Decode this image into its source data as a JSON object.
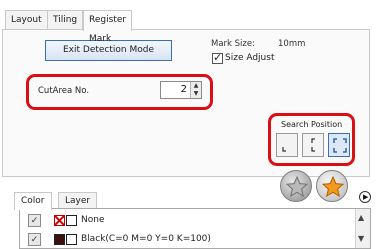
{
  "tabs": [
    {
      "label": "Layout",
      "active": false
    },
    {
      "label": "Tiling",
      "active": false
    },
    {
      "label": "Register Mark",
      "active": true
    }
  ],
  "register_mark": {
    "exit_detection_label": "Exit Detection Mode",
    "mark_size_label": "Mark Size:",
    "mark_size_value": "10mm",
    "size_adjust_label": "Size Adjust",
    "size_adjust_checked": true
  },
  "cut_area": {
    "label": "CutArea No.",
    "value": "2"
  },
  "search_position": {
    "label": "Search Position",
    "options": [
      "bottom-left-corner",
      "two-left-corners",
      "four-corners"
    ],
    "selected": "four-corners"
  },
  "lower_tabs": [
    {
      "label": "Color",
      "active": true
    },
    {
      "label": "Layer",
      "active": false
    }
  ],
  "color_list": [
    {
      "name": "None",
      "checked": true,
      "swatch_crossed": true
    },
    {
      "name": "Black(C=0 M=0 Y=0 K=100)",
      "checked": true,
      "swatch_color": "#3a1010"
    }
  ],
  "colors": {
    "highlight": "#dd0d14",
    "accent_blue": "#3a6fb6",
    "star_orange": "#f39a1e"
  },
  "icons": [
    "star-grey-icon",
    "star-orange-icon",
    "more-arrow-icon",
    "spin-up-icon",
    "spin-down-icon",
    "checkmark-icon"
  ]
}
